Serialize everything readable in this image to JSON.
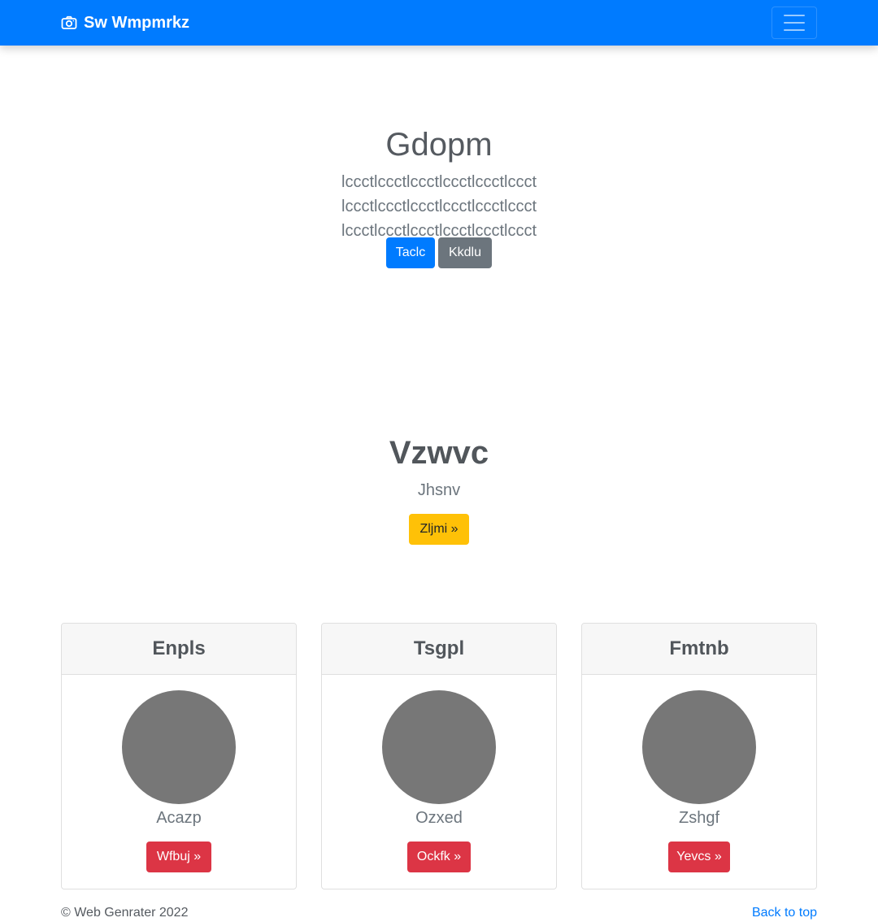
{
  "navbar": {
    "brand_text": "Sw Wmpmrkz",
    "brand_icon": "camera-icon",
    "toggler_icon": "hamburger-menu-icon",
    "background": "#007bff"
  },
  "hero": {
    "title": "Gdopm",
    "lead": "lccctlccctlccctlccctlccctlccct lccctlccctlccctlccctlccctlccct lccctlccctlccctlccctlccctlccct",
    "primary_button": "Taclc",
    "secondary_button": "Kkdlu"
  },
  "section": {
    "title": "Vzwvc",
    "subtitle": "Jhsnv",
    "button": "Zljmi »"
  },
  "cards": [
    {
      "header": "Enpls",
      "name": "Acazp",
      "button": "Wfbuj »"
    },
    {
      "header": "Tsgpl",
      "name": "Ozxed",
      "button": "Ockfk »"
    },
    {
      "header": "Fmtnb",
      "name": "Zshgf",
      "button": "Yevcs »"
    }
  ],
  "footer": {
    "copyright": "© Web Genrater 2022",
    "back_to_top": "Back to top"
  },
  "colors": {
    "primary": "#007bff",
    "secondary": "#6c757d",
    "warning": "#ffc107",
    "danger": "#dc3545",
    "avatar_placeholder": "#777777"
  }
}
